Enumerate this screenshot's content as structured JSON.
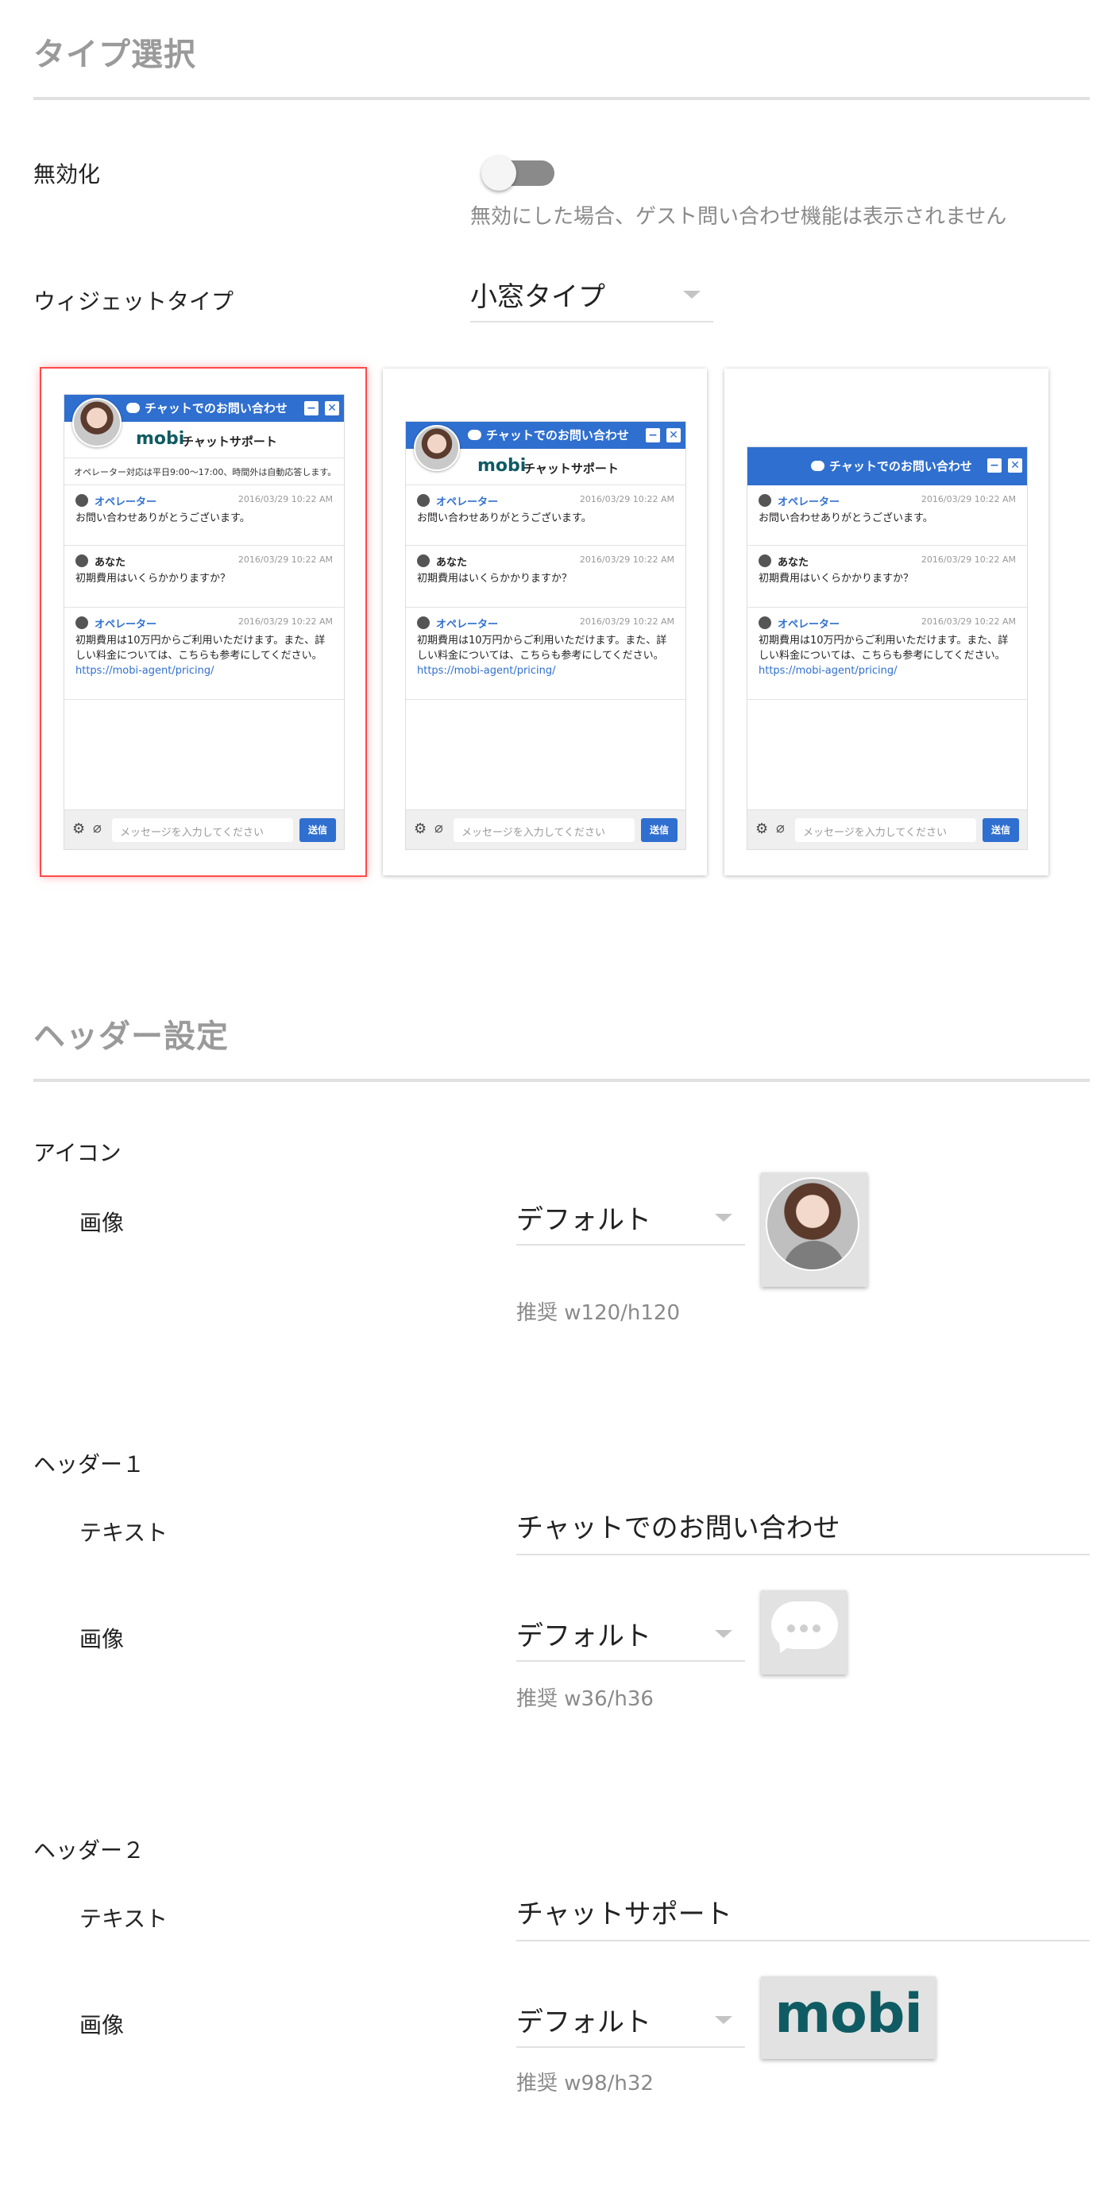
{
  "type_section": {
    "title": "タイプ選択",
    "disable_label": "無効化",
    "disable_hint": "無効にした場合、ゲスト問い合わせ機能は表示されません",
    "disable_enabled": false,
    "widget_type_label": "ウィジェットタイプ",
    "widget_type_value": "小窓タイプ"
  },
  "preview": {
    "header_title": "チャットでのお問い合わせ",
    "minimize": "−",
    "close": "✕",
    "logo": "mobi",
    "sub_title": "チャットサポート",
    "notice": "オペレーター対応は平日9:00〜17:00、時間外は自動応答します。",
    "messages": [
      {
        "name": "オペレーター",
        "time": "2016/03/29 10:22 AM",
        "body": "お問い合わせありがとうございます。"
      },
      {
        "name": "あなた",
        "time": "2016/03/29 10:22 AM",
        "body": "初期費用はいくらかかりますか？"
      },
      {
        "name": "オペレーター",
        "time": "2016/03/29 10:22 AM",
        "body": "初期費用は10万円からご利用いただけます。また、詳しい料金については、こちらも参考にしてください。",
        "link": "https://mobi-agent/pricing/"
      }
    ],
    "input_placeholder": "メッセージを入力してください",
    "send": "送信",
    "selected_index": 0
  },
  "header_section": {
    "title": "ヘッダー設定",
    "icon": {
      "label": "アイコン",
      "image_label": "画像",
      "image_value": "デフォルト",
      "image_hint": "推奨 w120/h120"
    },
    "header1": {
      "label": "ヘッダー１",
      "text_label": "テキスト",
      "text_value": "チャットでのお問い合わせ",
      "image_label": "画像",
      "image_value": "デフォルト",
      "image_hint": "推奨 w36/h36"
    },
    "header2": {
      "label": "ヘッダー２",
      "text_label": "テキスト",
      "text_value": "チャットサポート",
      "image_label": "画像",
      "image_value": "デフォルト",
      "image_hint": "推奨 w98/h32",
      "logo_text": "mobi"
    }
  },
  "colors": {
    "accent_blue": "#2f6fcf",
    "logo_teal": "#0f5b63",
    "selected_outline": "#ff4a4a",
    "section_title": "#9a9a9a"
  },
  "icons": [
    "toggle-switch",
    "chevron-down-icon",
    "chat-bubble-icon",
    "minimize-icon",
    "close-icon",
    "operator-icon",
    "user-icon",
    "gear-icon",
    "paperclip-icon",
    "operator-avatar",
    "chat-bubble-image"
  ]
}
